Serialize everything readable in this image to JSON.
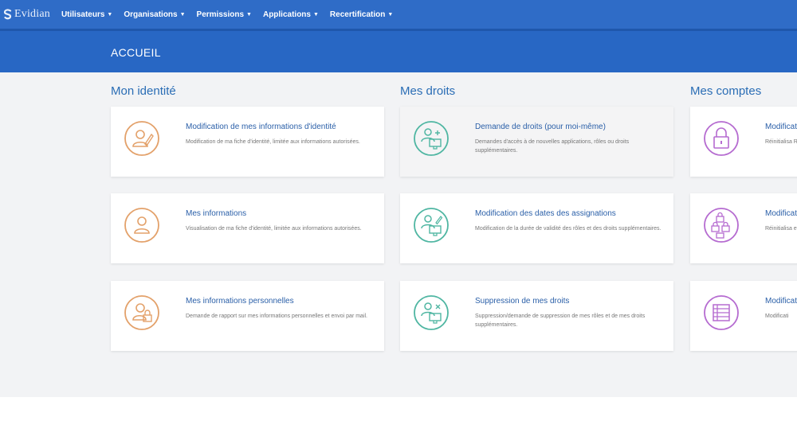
{
  "brand": {
    "name": "Evidian"
  },
  "nav": {
    "items": [
      {
        "label": "Utilisateurs"
      },
      {
        "label": "Organisations"
      },
      {
        "label": "Permissions"
      },
      {
        "label": "Applications"
      },
      {
        "label": "Recertification"
      }
    ]
  },
  "page": {
    "title": "ACCUEIL"
  },
  "colors": {
    "navbar": "#2f6cc7",
    "header": "#2867c4",
    "section_title": "#2a6db5",
    "identite_icon": "#e3a16a",
    "droits_icon": "#4fb6a2",
    "comptes_icon": "#b56bd0"
  },
  "sections": {
    "identite": {
      "title": "Mon identité",
      "cards": [
        {
          "icon": "user-edit-icon",
          "title": "Modification de mes informations d'identité",
          "desc": "Modification de ma fiche d'identité, limitée aux informations autorisées."
        },
        {
          "icon": "user-icon",
          "title": "Mes informations",
          "desc": "Visualisation de ma fiche d'identité, limitée aux informations autorisées."
        },
        {
          "icon": "user-lock-icon",
          "title": "Mes informations personnelles",
          "desc": "Demande de rapport sur mes informations personnelles et envoi par mail."
        }
      ]
    },
    "droits": {
      "title": "Mes droits",
      "cards": [
        {
          "icon": "user-monitor-add-icon",
          "title": "Demande de droits (pour moi-même)",
          "desc": "Demandes d'accès à de nouvelles applications, rôles ou droits supplémentaires."
        },
        {
          "icon": "user-monitor-edit-icon",
          "title": "Modification des dates des assignations",
          "desc": "Modification de la durée de validité des rôles et des droits supplémentaires."
        },
        {
          "icon": "user-monitor-remove-icon",
          "title": "Suppression de mes droits",
          "desc": "Suppression/demande de suppression de mes rôles et de mes droits supplémentaires."
        }
      ]
    },
    "comptes": {
      "title": "Mes comptes",
      "cards": [
        {
          "icon": "lock-icon",
          "title": "Modificat",
          "desc": "Réinitialisa Request M"
        },
        {
          "icon": "multi-lock-icon",
          "title": "Modificat",
          "desc": "Réinitialisa et resynchr"
        },
        {
          "icon": "list-icon",
          "title": "Modificat",
          "desc": "Modificati"
        }
      ]
    }
  }
}
